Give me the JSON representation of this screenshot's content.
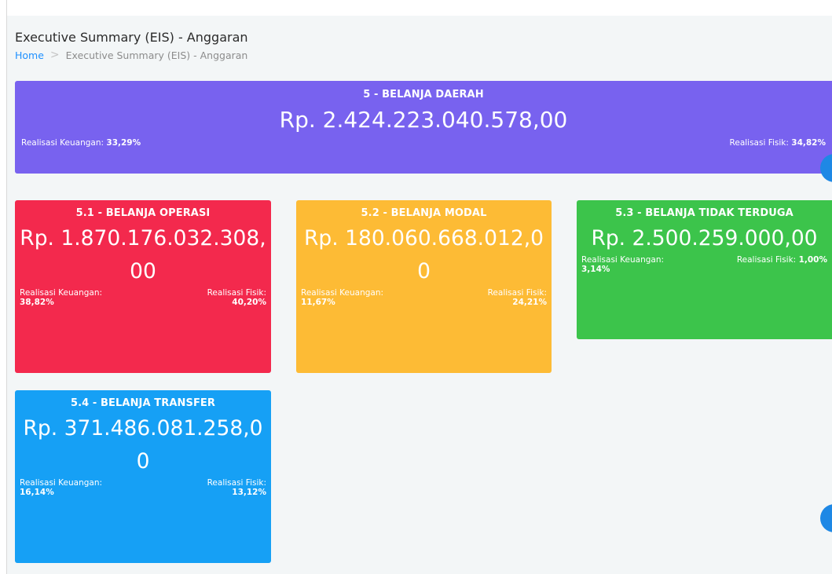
{
  "header": {
    "title": "Executive Summary (EIS) - Anggaran",
    "breadcrumb": {
      "home": "Home",
      "separator": ">",
      "current": "Executive Summary (EIS) - Anggaran"
    }
  },
  "total": {
    "title": "5 - BELANJA DAERAH",
    "amount": "Rp. 2.424.223.040.578,00",
    "keuangan_label": "Realisasi Keuangan:",
    "keuangan_value": "33,29%",
    "fisik_label": "Realisasi Fisik:",
    "fisik_value": "34,82%",
    "color": "#7862ef"
  },
  "cards": [
    {
      "title": "5.1 - BELANJA OPERASI",
      "amount": "Rp. 1.870.176.032.308,00",
      "keuangan_label": "Realisasi Keuangan:",
      "keuangan_value": "38,82%",
      "fisik_label": "Realisasi Fisik:",
      "fisik_value": "40,20%",
      "color": "#f3294d"
    },
    {
      "title": "5.2 - BELANJA MODAL",
      "amount": "Rp. 180.060.668.012,00",
      "keuangan_label": "Realisasi Keuangan:",
      "keuangan_value": "11,67%",
      "fisik_label": "Realisasi Fisik:",
      "fisik_value": "24,21%",
      "color": "#fdbb35"
    },
    {
      "title": "5.3 - BELANJA TIDAK TERDUGA",
      "amount": "Rp. 2.500.259.000,00",
      "keuangan_label": "Realisasi Keuangan:",
      "keuangan_value": "3,14%",
      "fisik_label": "Realisasi Fisik:",
      "fisik_value": "1,00%",
      "color": "#3cc44b"
    },
    {
      "title": "5.4 - BELANJA TRANSFER",
      "amount": "Rp. 371.486.081.258,00",
      "keuangan_label": "Realisasi Keuangan:",
      "keuangan_value": "16,14%",
      "fisik_label": "Realisasi Fisik:",
      "fisik_value": "13,12%",
      "color": "#16a0f5"
    }
  ],
  "fab_color": "#1e88e5"
}
